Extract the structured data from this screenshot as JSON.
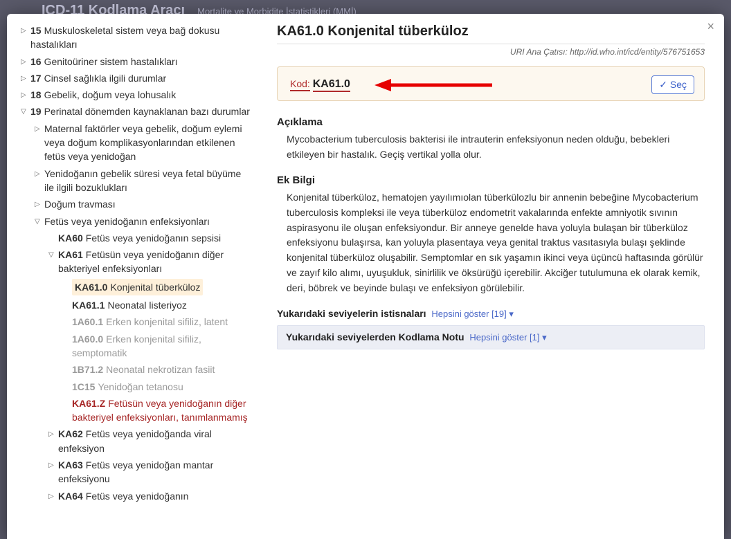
{
  "bgHeader": {
    "title": "ICD-11 Kodlama Aracı",
    "sub": "Mortalite ve Morbidite İstatistikleri (MMİ)"
  },
  "closeGlyph": "×",
  "tree": [
    {
      "ind": 0,
      "arrow": "▷",
      "num": "15",
      "label": "Muskuloskeletal sistem veya bağ dokusu hastalıkları"
    },
    {
      "ind": 0,
      "arrow": "▷",
      "num": "16",
      "label": "Genitoüriner sistem hastalıkları"
    },
    {
      "ind": 0,
      "arrow": "▷",
      "num": "17",
      "label": "Cinsel sağlıkla ilgili durumlar"
    },
    {
      "ind": 0,
      "arrow": "▷",
      "num": "18",
      "label": "Gebelik, doğum veya lohusalık"
    },
    {
      "ind": 0,
      "arrow": "▽",
      "num": "19",
      "label": "Perinatal dönemden kaynaklanan bazı durumlar"
    },
    {
      "ind": 1,
      "arrow": "▷",
      "label": "Maternal faktörler veya gebelik, doğum eylemi veya doğum komplikasyonlarından etkilenen fetüs veya yenidoğan"
    },
    {
      "ind": 1,
      "arrow": "▷",
      "label": "Yenidoğanın gebelik süresi veya fetal büyüme ile ilgili bozuklukları"
    },
    {
      "ind": 1,
      "arrow": "▷",
      "label": "Doğum travması"
    },
    {
      "ind": 1,
      "arrow": "▽",
      "label": "Fetüs veya yenidoğanın enfeksiyonları"
    },
    {
      "ind": 2,
      "arrow": "",
      "code": "KA60",
      "label": "Fetüs veya yenidoğanın sepsisi"
    },
    {
      "ind": 2,
      "arrow": "▽",
      "code": "KA61",
      "label": "Fetüsün veya yenidoğanın diğer bakteriyel enfeksiyonları"
    },
    {
      "ind": 3,
      "arrow": "",
      "code": "KA61.0",
      "label": "Konjenital tüberküloz",
      "selected": true
    },
    {
      "ind": 3,
      "arrow": "",
      "code": "KA61.1",
      "label": "Neonatal listeriyoz"
    },
    {
      "ind": 3,
      "arrow": "",
      "code": "1A60.1",
      "label": "Erken konjenital sifiliz, latent",
      "muted": true
    },
    {
      "ind": 3,
      "arrow": "",
      "code": "1A60.0",
      "label": "Erken konjenital sifiliz, semptomatik",
      "muted": true
    },
    {
      "ind": 3,
      "arrow": "",
      "code": "1B71.2",
      "label": "Neonatal nekrotizan fasiit",
      "muted": true
    },
    {
      "ind": 3,
      "arrow": "",
      "code": "1C15",
      "label": "Yenidoğan tetanosu",
      "muted": true
    },
    {
      "ind": 3,
      "arrow": "",
      "code": "KA61.Z",
      "label": "Fetüsün veya yenidoğanın diğer bakteriyel enfeksiyonları, tanımlanmamış",
      "red": true
    },
    {
      "ind": 2,
      "arrow": "▷",
      "code": "KA62",
      "label": "Fetüs veya yenidoğanda viral enfeksiyon"
    },
    {
      "ind": 2,
      "arrow": "▷",
      "code": "KA63",
      "label": "Fetüs veya yenidoğan mantar enfeksiyonu"
    },
    {
      "ind": 2,
      "arrow": "▷",
      "code": "KA64",
      "label": "Fetüs veya yenidoğanın"
    }
  ],
  "detail": {
    "title": "KA61.0 Konjenital tüberküloz",
    "uriLabel": "URI Ana Çatısı:",
    "uri": "http://id.who.int/icd/entity/576751653",
    "kodLabel": "Kod:",
    "kodValue": "KA61.0",
    "secLabel": "✓ Seç",
    "descHeading": "Açıklama",
    "desc": "Mycobacterium tuberculosis bakterisi ile intrauterin enfeksiyonun neden olduğu, bebekleri etkileyen bir hastalık. Geçiş vertikal yolla olur.",
    "addHeading": "Ek Bilgi",
    "add": "Konjenital tüberküloz, hematojen yayılımıolan tüberkülozlu bir annenin bebeğine Mycobacterium tuberculosis kompleksi ile veya tüberküloz endometrit vakalarında enfekte amniyotik sıvının aspirasyonu ile oluşan enfeksiyondur. Bir anneye genelde hava yoluyla bulaşan bir tüberküloz enfeksiyonu bulaşırsa, kan yoluyla plasentaya veya genital traktus vasıtasıyla bulaşı şeklinde konjenital tüberküloz oluşabilir. Semptomlar en sık yaşamın ikinci veya üçüncü haftasında görülür ve zayıf kilo alımı, uyuşukluk, sinirlilik ve öksürüğü içerebilir. Akciğer tutulumuna ek olarak kemik, deri, böbrek ve beyinde bulaşı ve enfeksiyon görülebilir.",
    "excHeading": "Yukarıdaki seviyelerin istisnaları",
    "excLink": "Hepsini göster [19] ▾",
    "noteHeading": "Yukarıdaki seviyelerden Kodlama Notu",
    "noteLink": "Hepsini göster [1] ▾"
  }
}
